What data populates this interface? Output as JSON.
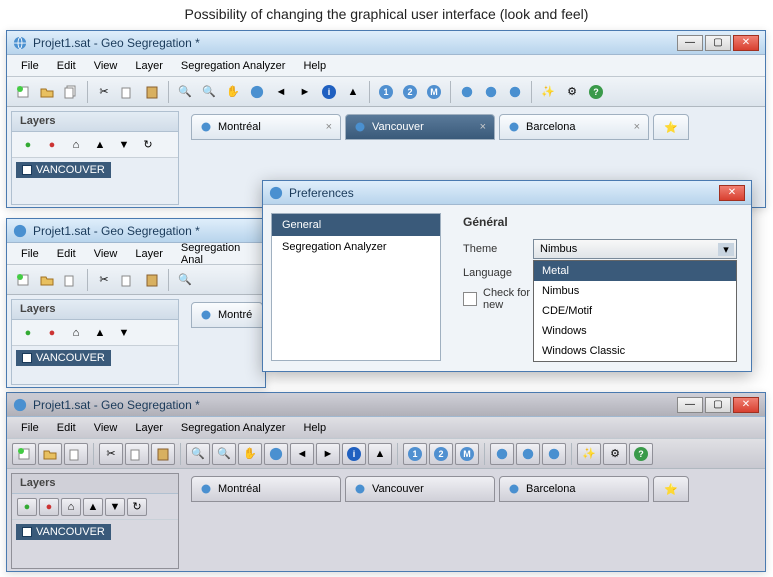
{
  "caption": "Possibility of changing the graphical user interface (look and feel)",
  "app": {
    "title": "Projet1.sat - Geo Segregation *",
    "menu": [
      "File",
      "Edit",
      "View",
      "Layer",
      "Segregation Analyzer",
      "Help"
    ]
  },
  "layers": {
    "title": "Layers",
    "item": "VANCOUVER"
  },
  "tabs": [
    {
      "label": "Montréal",
      "active": false
    },
    {
      "label": "Vancouver",
      "active": true
    },
    {
      "label": "Barcelona",
      "active": false
    }
  ],
  "toolbar_icons": {
    "new": "new-layer-icon",
    "open": "open-icon",
    "copy": "copy-icon",
    "cut": "cut-icon",
    "copy2": "copy-icon",
    "paste": "paste-icon",
    "zoomin": "zoom-in-icon",
    "zoomout": "zoom-out-icon",
    "pan": "pan-icon",
    "globe": "globe-icon",
    "back": "back-icon",
    "forward": "forward-icon",
    "info": "info-icon",
    "pointer": "pointer-icon",
    "n1": "1",
    "n2": "2",
    "nm": "M",
    "g1": "globe-icon",
    "g2": "globe-icon",
    "g3": "globe-icon",
    "wand": "wand-icon",
    "gear": "gear-icon",
    "help": "help-icon"
  },
  "side_icons": [
    "add-icon",
    "remove-icon",
    "home-icon",
    "up-icon",
    "down-icon",
    "refresh-icon"
  ],
  "prefs": {
    "title": "Preferences",
    "categories": [
      "General",
      "Segregation Analyzer"
    ],
    "section": "Général",
    "theme_label": "Theme",
    "theme_value": "Nimbus",
    "language_label": "Language",
    "check_label": "Check for new",
    "theme_options": [
      "Metal",
      "Nimbus",
      "CDE/Motif",
      "Windows",
      "Windows Classic"
    ]
  }
}
